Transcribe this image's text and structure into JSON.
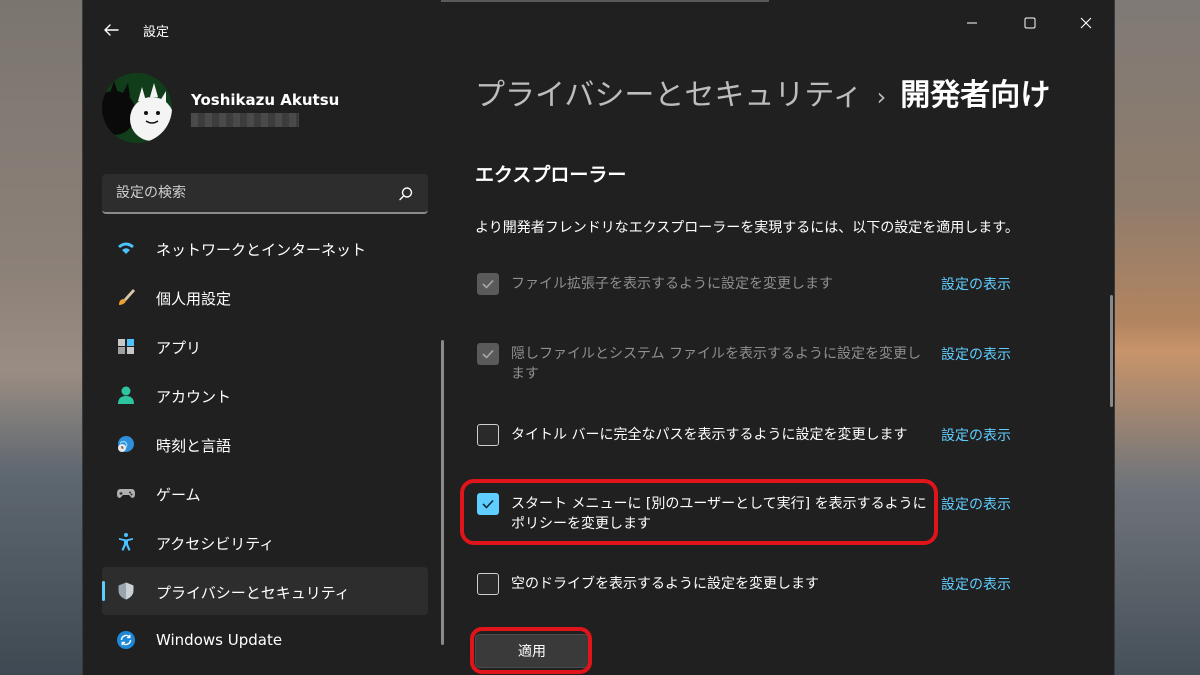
{
  "window": {
    "title": "設定"
  },
  "profile": {
    "name": "Yoshikazu Akutsu"
  },
  "search": {
    "placeholder": "設定の検索"
  },
  "sidebar": {
    "items": [
      {
        "label": "ネットワークとインターネット",
        "icon": "wifi-icon"
      },
      {
        "label": "個人用設定",
        "icon": "brush-icon"
      },
      {
        "label": "アプリ",
        "icon": "apps-icon"
      },
      {
        "label": "アカウント",
        "icon": "account-icon"
      },
      {
        "label": "時刻と言語",
        "icon": "globe-clock-icon"
      },
      {
        "label": "ゲーム",
        "icon": "gamepad-icon"
      },
      {
        "label": "アクセシビリティ",
        "icon": "accessibility-icon"
      },
      {
        "label": "プライバシーとセキュリティ",
        "icon": "shield-icon",
        "active": true
      },
      {
        "label": "Windows Update",
        "icon": "update-icon"
      }
    ]
  },
  "breadcrumb": {
    "parent": "プライバシーとセキュリティ",
    "separator": "›",
    "current": "開発者向け"
  },
  "section": {
    "title": "エクスプローラー",
    "description": "より開発者フレンドリなエクスプローラーを実現するには、以下の設定を適用します。"
  },
  "settings": [
    {
      "label": "ファイル拡張子を表示するように設定を変更します",
      "checked": true,
      "disabled": true,
      "link": "設定の表示"
    },
    {
      "label": "隠しファイルとシステム ファイルを表示するように設定を変更します",
      "checked": true,
      "disabled": true,
      "link": "設定の表示"
    },
    {
      "label": "タイトル バーに完全なパスを表示するように設定を変更します",
      "checked": false,
      "disabled": false,
      "link": "設定の表示"
    },
    {
      "label": "スタート メニューに [別のユーザーとして実行] を表示するようにポリシーを変更します",
      "checked": true,
      "disabled": false,
      "link": "設定の表示"
    },
    {
      "label": "空のドライブを表示するように設定を変更します",
      "checked": false,
      "disabled": false,
      "link": "設定の表示"
    }
  ],
  "actions": {
    "apply_label": "適用"
  },
  "colors": {
    "accent": "#60cdff",
    "highlight": "#e0141b",
    "window_bg": "#202020"
  }
}
